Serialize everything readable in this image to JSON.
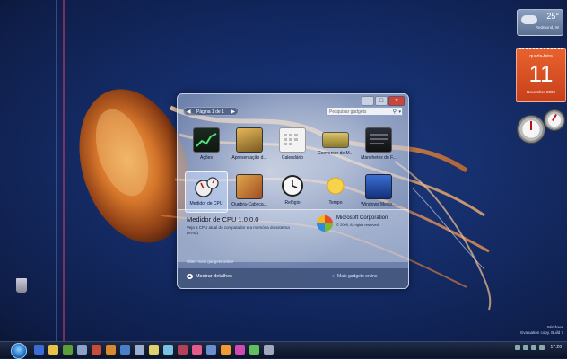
{
  "gadget_window": {
    "pager_label": "Página 1 de 1",
    "search_placeholder": "Pesquisar gadgets",
    "gadgets": [
      {
        "label": "Ações",
        "icon": "stocks-icon"
      },
      {
        "label": "Apresentação d...",
        "icon": "slideshow-icon"
      },
      {
        "label": "Calendário",
        "icon": "calendar-icon"
      },
      {
        "label": "Conversor de M...",
        "icon": "currency-icon"
      },
      {
        "label": "Manchetes do F...",
        "icon": "feed-icon"
      },
      {
        "label": "Medidor de CPU",
        "icon": "cpu-meter-icon"
      },
      {
        "label": "Quebra-Cabeça...",
        "icon": "puzzle-icon"
      },
      {
        "label": "Relógio",
        "icon": "clock-icon"
      },
      {
        "label": "Tempo",
        "icon": "weather-icon"
      },
      {
        "label": "Windows Media...",
        "icon": "media-center-icon"
      }
    ],
    "details": {
      "title": "Medidor de CPU 1.0.0.0",
      "description": "Veja a CPU atual do computador e a memória do sistema (RAM).",
      "publisher": "Microsoft Corporation",
      "copyright": "© 2009, All rights reserved"
    },
    "online_link": "Obter mais gadgets online",
    "show_details": "Mostrar detalhes",
    "more_gadgets": "Mais gadgets online"
  },
  "weather_gadget": {
    "temp": "25°",
    "city": "Redmond, W"
  },
  "calendar_gadget": {
    "weekday": "quarta-feira",
    "day": "11",
    "month_year": "Novembro 2009"
  },
  "watermark": {
    "line1": "Windows",
    "line2": "Evaluation copy. Build 7"
  },
  "taskbar": {
    "clock": "17:26"
  }
}
